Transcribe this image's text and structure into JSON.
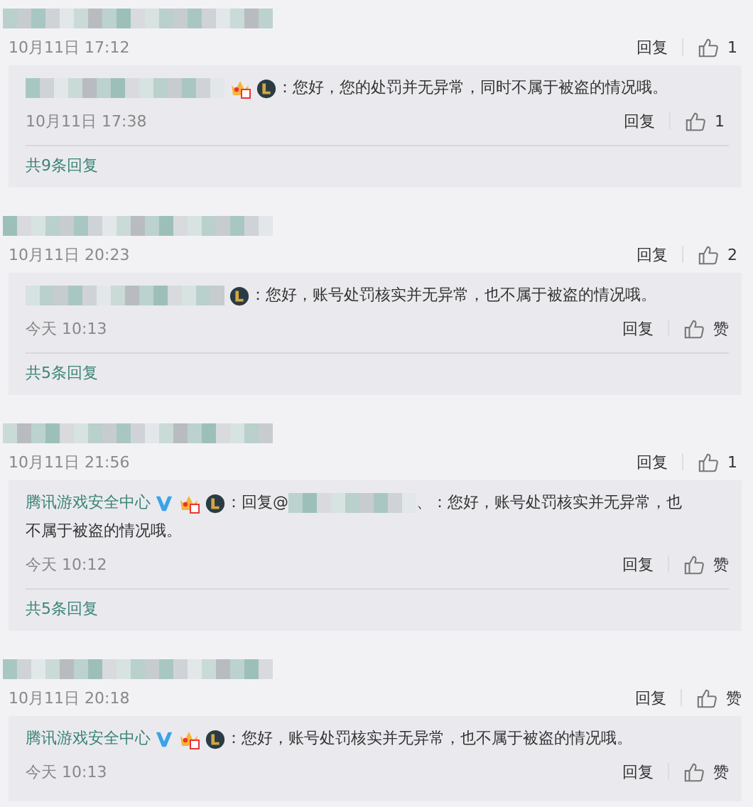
{
  "comments": [
    {
      "author_blurred": true,
      "time": "10月11日 17:12",
      "reply_label": "回复",
      "like": "1",
      "replies": [
        {
          "author_blurred": true,
          "crown": true,
          "game_badge": true,
          "verified": false,
          "parts": [
            {
              "kind": "text",
              "text": "：您好，您的处罚并无异常，同时不属于被盗的情况哦。"
            }
          ],
          "time": "10月11日 17:38",
          "reply_label": "回复",
          "like": "1"
        }
      ],
      "reply_count": "共9条回复"
    },
    {
      "author_blurred": true,
      "time": "10月11日 20:23",
      "reply_label": "回复",
      "like": "2",
      "replies": [
        {
          "author_blurred": true,
          "crown": false,
          "game_badge": true,
          "verified": false,
          "parts": [
            {
              "kind": "text",
              "text": "：您好，账号处罚核实并无异常，也不属于被盗的情况哦。"
            }
          ],
          "time": "今天 10:13",
          "reply_label": "回复",
          "like": "赞"
        }
      ],
      "reply_count": "共5条回复"
    },
    {
      "author_blurred": true,
      "time": "10月11日 21:56",
      "reply_label": "回复",
      "like": "1",
      "replies": [
        {
          "author_blurred": false,
          "author": "腾讯游戏安全中心",
          "crown": true,
          "game_badge": true,
          "verified": true,
          "parts": [
            {
              "kind": "text",
              "text": "：回复@"
            },
            {
              "kind": "blurred"
            },
            {
              "kind": "text",
              "text": "、：您好，账号处罚核实并无异常，也"
            },
            {
              "kind": "text",
              "text": "不属于被盗的情况哦。"
            }
          ],
          "time": "今天 10:12",
          "reply_label": "回复",
          "like": "赞"
        }
      ],
      "reply_count": "共5条回复"
    },
    {
      "author_blurred": true,
      "time": "10月11日 20:18",
      "reply_label": "回复",
      "like": "赞",
      "replies": [
        {
          "author_blurred": false,
          "author": "腾讯游戏安全中心",
          "crown": true,
          "game_badge": true,
          "verified": true,
          "parts": [
            {
              "kind": "text",
              "text": "：您好，账号处罚核实并无异常，也不属于被盗的情况哦。"
            }
          ],
          "time": "今天 10:13",
          "reply_label": "回复",
          "like": "赞"
        }
      ]
    }
  ]
}
